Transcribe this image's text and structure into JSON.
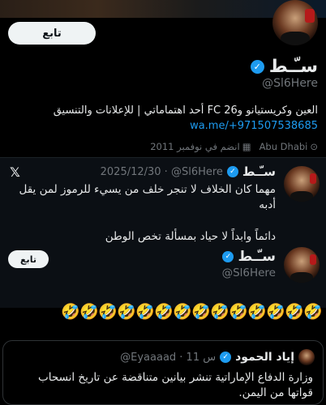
{
  "profile": {
    "follow_label": "تابع",
    "name": "سـّـط",
    "handle": "@Sl6Here",
    "bio": "العين وكريستيانو وFC 26 أحد اهتماماتي | للإعلانات والتنسيق",
    "link": "wa.me/+971507538685",
    "joined": "انضم في نوفمبر 2011",
    "location": "Abu Dhabi"
  },
  "card": {
    "x_icon": "𝕏",
    "name": "سـّـط",
    "handle_date": "2025/12/30 · @Sl6Here",
    "text_line1": "مهما كان الخلاف لا تنجر خلف من يسيء للرموز لمن يقل أدبه",
    "text_line2": "دائماً وابداً لا حياد بمسألة تخص الوطن",
    "follow_label": "تابع",
    "name2": "سـّـط",
    "handle2": "@Sl6Here"
  },
  "emojis": [
    "🤣",
    "🤣",
    "🤣",
    "🤣",
    "🤣",
    "🤣",
    "🤣",
    "🤣",
    "🤣",
    "🤣",
    "🤣",
    "🤣",
    "🤣",
    "🤣"
  ],
  "quote": {
    "name": "إياد الحمود",
    "meta": "@Eyaaaad · 11 س",
    "text": "وزارة الدفاع الإماراتية تنشر بيانين متناقضة عن تاريخ انسحاب قواتها من اليمن."
  }
}
